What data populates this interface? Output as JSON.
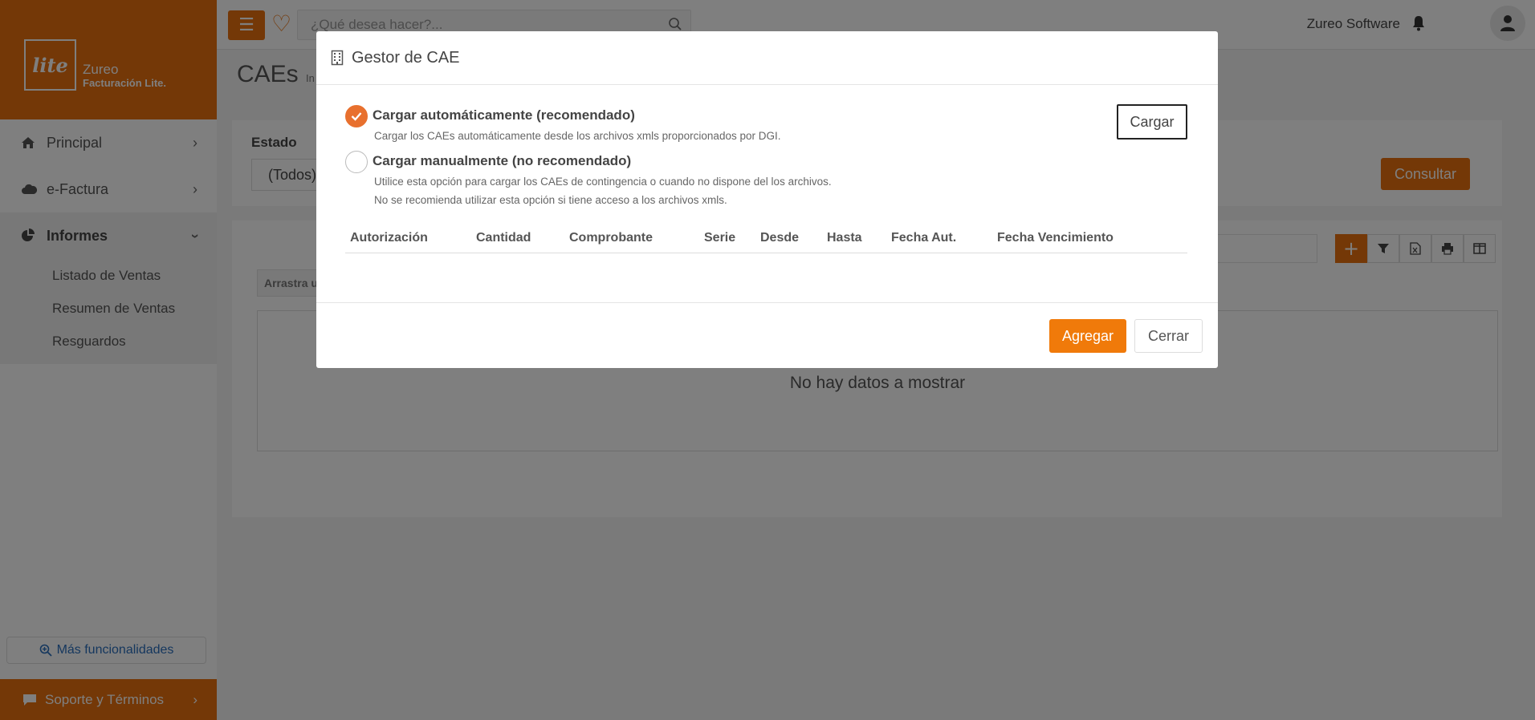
{
  "brand": {
    "logo_text": "lite",
    "name": "Zureo",
    "product": "Facturación Lite."
  },
  "sidebar": {
    "items": [
      {
        "label": "Principal",
        "icon": "home-icon"
      },
      {
        "label": "e-Factura",
        "icon": "cloud-icon"
      },
      {
        "label": "Informes",
        "icon": "pie-chart-icon"
      }
    ],
    "submenu": [
      "Listado de Ventas",
      "Resumen de Ventas",
      "Resguardos"
    ],
    "more": "Más funcionalidades",
    "support": "Soporte y Términos"
  },
  "topbar": {
    "search_placeholder": "¿Qué desea hacer?...",
    "user_name": "Zureo Software"
  },
  "page": {
    "title": "CAEs",
    "crumb": "In",
    "filter_label": "Estado",
    "filter_value": "(Todos)",
    "consultar": "Consultar",
    "drag_hint": "Arrastra u",
    "no_data": "No hay datos a mostrar"
  },
  "modal": {
    "title": "Gestor de CAE",
    "option_auto": {
      "title": "Cargar automáticamente (recomendado)",
      "desc": "Cargar los CAEs automáticamente desde los archivos xmls proporcionados por DGI.",
      "checked": true
    },
    "option_manual": {
      "title": "Cargar manualmente (no recomendado)",
      "desc1": "Utilice esta opción para cargar los CAEs de contingencia o cuando no dispone del los archivos.",
      "desc2": "No se recomienda utilizar esta opción si tiene acceso a los archivos xmls.",
      "checked": false
    },
    "cargar": "Cargar",
    "columns": [
      "Autorización",
      "Cantidad",
      "Comprobante",
      "Serie",
      "Desde",
      "Hasta",
      "Fecha Aut.",
      "Fecha Vencimiento"
    ],
    "agregar": "Agregar",
    "cerrar": "Cerrar"
  },
  "colors": {
    "accent": "#e8700e",
    "overlay": "rgba(0,0,0,0.5)"
  }
}
